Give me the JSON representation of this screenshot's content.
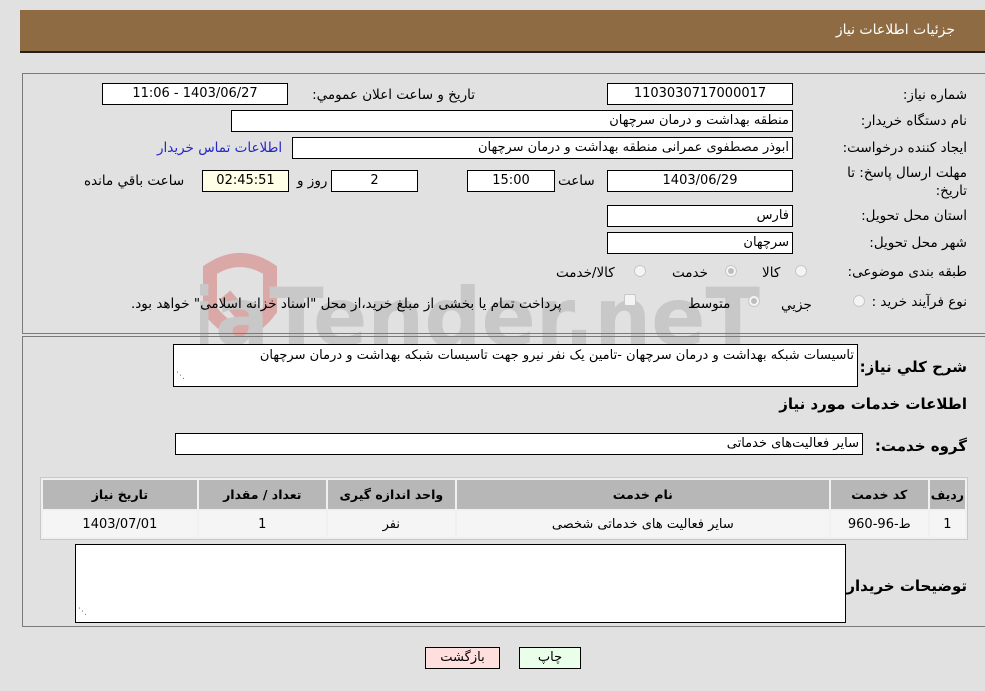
{
  "header": {
    "title": "جزئیات اطلاعات نیاز"
  },
  "fields": {
    "need_number": {
      "label": "شماره نیاز:",
      "value": "1103030717000017"
    },
    "announce_datetime": {
      "label": "تاریخ و ساعت اعلان عمومي:",
      "value": "1403/06/27 - 11:06"
    },
    "buyer_org": {
      "label": "نام دستگاه خریدار:",
      "value": "منطقه بهداشت و درمان سرچهان"
    },
    "requester": {
      "label": "ایجاد کننده درخواست:",
      "value": "ابوذر مصطفوی عمرانی منطقه بهداشت و درمان سرچهان"
    },
    "buyer_contact_link": "اطلاعات تماس خریدار",
    "deadline": {
      "label_line1": "مهلت ارسال پاسخ: تا",
      "label_line2": "تاریخ:",
      "date": "1403/06/29",
      "time_label": "ساعت",
      "time": "15:00",
      "days": "2",
      "days_label": "روز و",
      "remaining": "02:45:51",
      "remaining_label": "ساعت باقي مانده"
    },
    "province": {
      "label": "استان محل تحویل:",
      "value": "فارس"
    },
    "city": {
      "label": "شهر محل تحویل:",
      "value": "سرچهان"
    },
    "category": {
      "label": "طبقه بندی موضوعی:",
      "options": [
        "کالا",
        "خدمت",
        "کالا/خدمت"
      ],
      "selected": "خدمت"
    },
    "purchase_type": {
      "label": "نوع فرآیند خرید :",
      "options": [
        "جزيي",
        "متوسط"
      ],
      "selected": "متوسط",
      "treasury_note": "پرداخت تمام یا بخشی از مبلغ خرید،از محل \"اسناد خزانه اسلامی\" خواهد بود."
    }
  },
  "description": {
    "label": "شرح کلي نیاز:",
    "value": "تاسیسات شبکه بهداشت و درمان سرچهان -تامین یک نفر نیرو جهت تاسیسات شبکه بهداشت و درمان سرچهان"
  },
  "services_section": {
    "title": "اطلاعات خدمات مورد نیاز",
    "group_label": "گروه خدمت:",
    "group_value": "سایر فعالیت‌های خدماتی",
    "table": {
      "headers": [
        "ردیف",
        "کد خدمت",
        "نام خدمت",
        "واحد اندازه گیری",
        "تعداد / مقدار",
        "تاریخ نیاز"
      ],
      "rows": [
        [
          "1",
          "ط-96-960",
          "سایر فعالیت های خدماتی شخصی",
          "نفر",
          "1",
          "1403/07/01"
        ]
      ]
    }
  },
  "buyer_notes": {
    "label": "توضیحات خریدار:",
    "value": ""
  },
  "buttons": {
    "print": "چاپ",
    "back": "بازگشت"
  },
  "watermark": {
    "text": "AriaTender.neT"
  },
  "colors": {
    "header_bg": "#8e6b42",
    "print_bg": "#eaffea",
    "back_bg": "#ffdede",
    "remaining_bg": "#ffffe8",
    "link": "#2525c8"
  }
}
